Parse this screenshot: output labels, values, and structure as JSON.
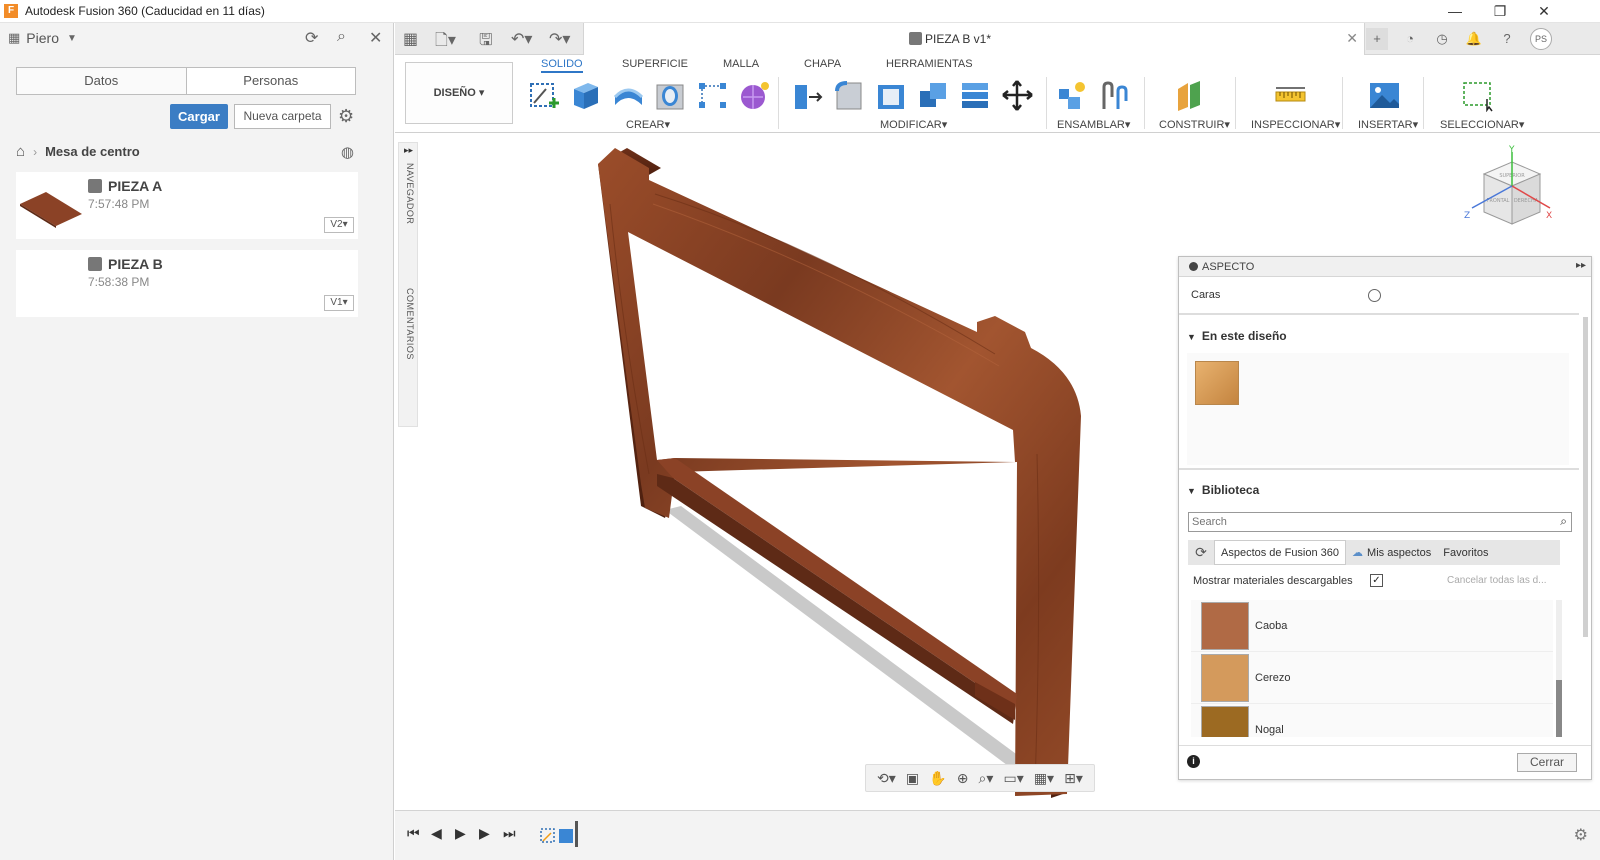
{
  "window": {
    "title": "Autodesk Fusion 360 (Caducidad en 11 días)",
    "logo_letter": "F",
    "minimize": "—",
    "maximize": "❐",
    "close": "✕"
  },
  "data_panel": {
    "user": "Piero",
    "tabs": [
      "Datos",
      "Personas"
    ],
    "upload_label": "Cargar",
    "new_folder_label": "Nueva carpeta",
    "breadcrumb": "Mesa de centro",
    "files": [
      {
        "name": "PIEZA A",
        "time": "7:57:48 PM",
        "version": "V2"
      },
      {
        "name": "PIEZA B",
        "time": "7:58:38 PM",
        "version": "V1"
      }
    ]
  },
  "document": {
    "title": "PIEZA B v1*",
    "avatar": "PS"
  },
  "ribbon": {
    "workspace": "DISEÑO",
    "tabs": [
      "SOLIDO",
      "SUPERFICIE",
      "MALLA",
      "CHAPA",
      "HERRAMIENTAS"
    ],
    "active_tab": "SOLIDO",
    "groups": [
      "CREAR",
      "MODIFICAR",
      "ENSAMBLAR",
      "CONSTRUIR",
      "INSPECCIONAR",
      "INSERTAR",
      "SELECCIONAR"
    ]
  },
  "browser": {
    "navigator": "NAVEGADOR",
    "comments": "COMENTARIOS"
  },
  "viewcube": {
    "top": "SUPERIOR",
    "front": "FRONTAL",
    "right": "DERECHA",
    "axis_x": "X",
    "axis_y": "Y",
    "axis_z": "Z"
  },
  "aspect_panel": {
    "title": "ASPECTO",
    "faces_label": "Caras",
    "in_design_label": "En este diseño",
    "library_label": "Biblioteca",
    "search_placeholder": "Search",
    "library_tabs": [
      "Aspectos de Fusion 360",
      "Mis aspectos",
      "Favoritos"
    ],
    "show_downloadable": "Mostrar materiales descargables",
    "cancel_all": "Cancelar todas las d...",
    "materials": [
      {
        "name": "Caoba",
        "color": "#b06a45"
      },
      {
        "name": "Cerezo",
        "color": "#d49a5c"
      },
      {
        "name": "Nogal",
        "color": "#9c6a22"
      }
    ],
    "close_label": "Cerrar"
  },
  "colors": {
    "accent": "#2f77c7",
    "wood": "#8b4226",
    "wood_dark": "#5e2a16"
  }
}
